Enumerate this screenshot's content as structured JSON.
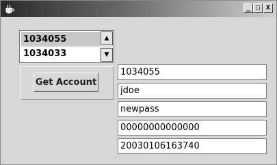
{
  "window": {
    "icon": "coffee-cup-app-icon",
    "controls": {
      "minimize": "_",
      "maximize": "□",
      "close": "X"
    }
  },
  "account_list": {
    "items": [
      "1034055",
      "1034033"
    ],
    "selected_index": 0,
    "scroll_up_icon": "▲",
    "scroll_down_icon": "▼"
  },
  "actions": {
    "get_account_label": "Get Account"
  },
  "fields": [
    "1034055",
    "jdoe",
    "newpass",
    "00000000000000",
    "20030106163740"
  ]
}
